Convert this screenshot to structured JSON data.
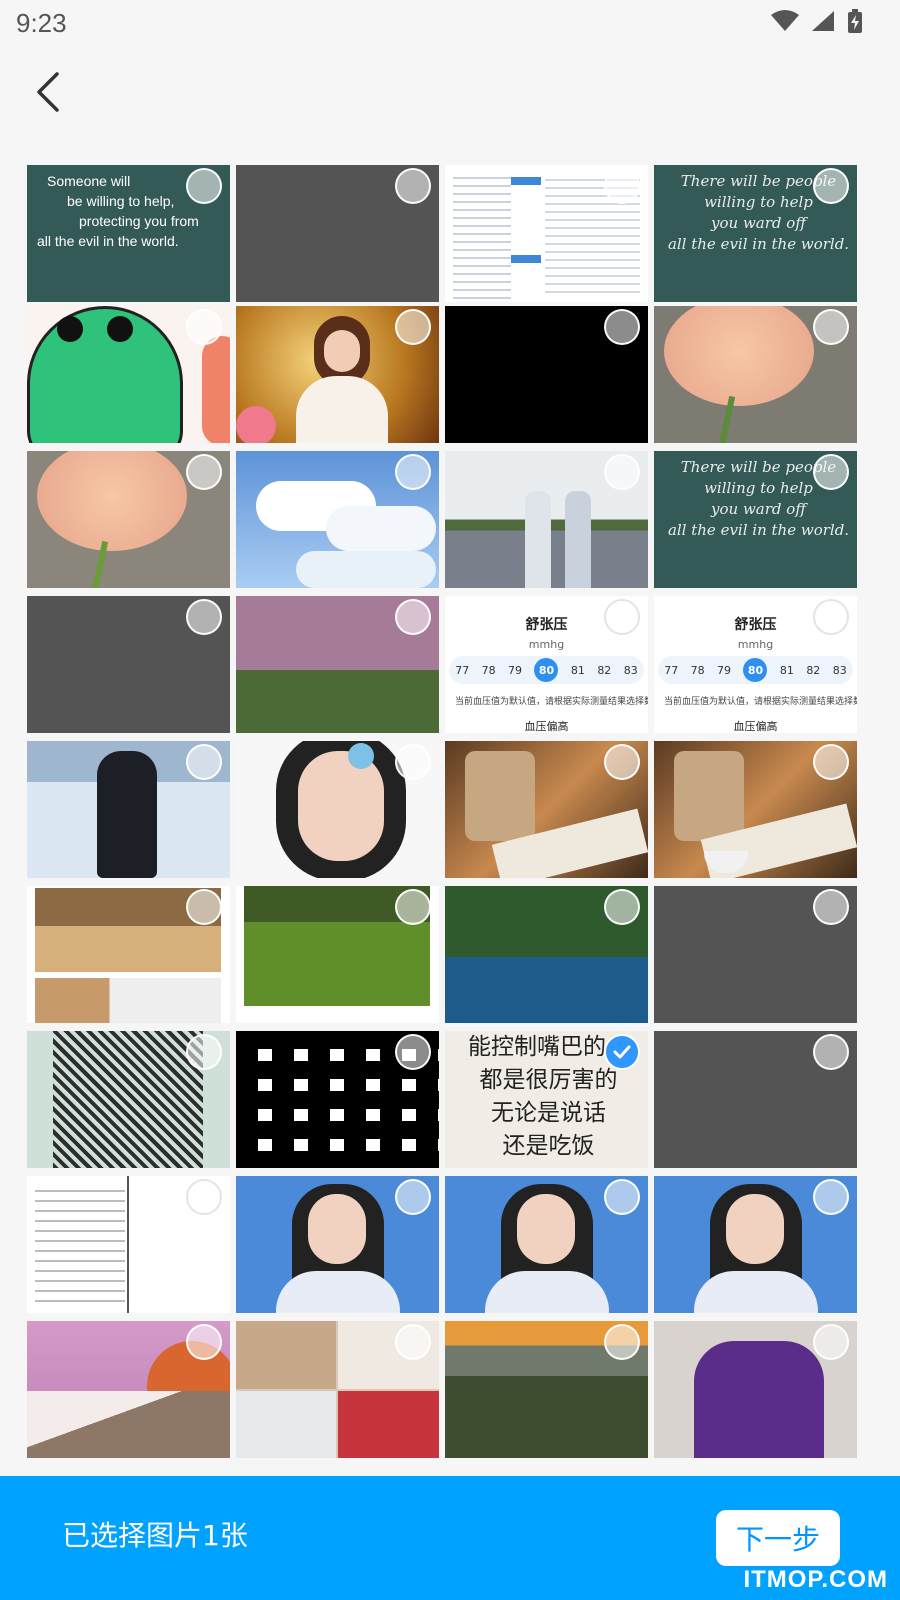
{
  "status_bar": {
    "time": "9:23"
  },
  "photos": [
    {
      "name": "photo-quote-english",
      "selected": false
    },
    {
      "name": "photo-gray-placeholder",
      "selected": false
    },
    {
      "name": "photo-resume-document",
      "selected": false
    },
    {
      "name": "photo-quote-script",
      "selected": false
    },
    {
      "name": "photo-green-cat",
      "selected": false
    },
    {
      "name": "photo-woman-red-glasses",
      "selected": false
    },
    {
      "name": "photo-black",
      "selected": false
    },
    {
      "name": "photo-peach-rose",
      "selected": false
    },
    {
      "name": "photo-peach-rose",
      "selected": false
    },
    {
      "name": "photo-clouds-sky",
      "selected": false
    },
    {
      "name": "photo-girls-in-field",
      "selected": false
    },
    {
      "name": "photo-quote-script",
      "selected": false
    },
    {
      "name": "photo-gray-placeholder",
      "selected": false
    },
    {
      "name": "photo-pink-sky-grass",
      "selected": false
    },
    {
      "name": "photo-blood-pressure-app",
      "selected": false
    },
    {
      "name": "photo-blood-pressure-app",
      "selected": false
    },
    {
      "name": "photo-person-in-snow",
      "selected": false
    },
    {
      "name": "photo-woman-portrait-flower",
      "selected": false
    },
    {
      "name": "photo-book-and-tea",
      "selected": false
    },
    {
      "name": "photo-book-and-tea",
      "selected": false
    },
    {
      "name": "photo-office-collage",
      "selected": false
    },
    {
      "name": "photo-moss-forest",
      "selected": false
    },
    {
      "name": "photo-leaves-and-lake",
      "selected": false
    },
    {
      "name": "photo-gray-placeholder",
      "selected": false
    },
    {
      "name": "photo-qr-code-green",
      "selected": false
    },
    {
      "name": "photo-qr-code-closeup",
      "selected": false
    },
    {
      "name": "photo-handwritten-chinese",
      "selected": true
    },
    {
      "name": "photo-gray-placeholder",
      "selected": false
    },
    {
      "name": "photo-code-document",
      "selected": false
    },
    {
      "name": "photo-woman-blue-background",
      "selected": false
    },
    {
      "name": "photo-woman-blue-background",
      "selected": false
    },
    {
      "name": "photo-woman-blue-background",
      "selected": false
    },
    {
      "name": "photo-pink-mountains-moon",
      "selected": false
    },
    {
      "name": "photo-fashion-collage",
      "selected": false
    },
    {
      "name": "photo-mountain-valley",
      "selected": false
    },
    {
      "name": "photo-woman-purple-dress",
      "selected": false
    }
  ],
  "tile_text": {
    "quote_en": [
      "Someone will",
      "be willing to help,",
      "protecting you from",
      "all the evil in the world."
    ],
    "quote_script": [
      "There will be people",
      "willing to help",
      "you ward off",
      "all the evil in the world."
    ],
    "bp_title": "舒张压",
    "bp_unit": "mmhg",
    "bp_values": [
      "77",
      "78",
      "79",
      "80",
      "81",
      "82",
      "83"
    ],
    "bp_hint": "当前血压值为默认值，请根据实际测量结果选择数据",
    "bp_bottom": "血压偏高",
    "cn_note": [
      "能控制嘴巴的人",
      "都是很厉害的",
      "无论是说话",
      "还是吃饭"
    ]
  },
  "footer": {
    "selected_label": "已选择图片1张",
    "next_label": "下一步",
    "watermark": "ITMOP.COM"
  },
  "colors": {
    "accent": "#00a2ff",
    "check": "#2f97ff"
  }
}
